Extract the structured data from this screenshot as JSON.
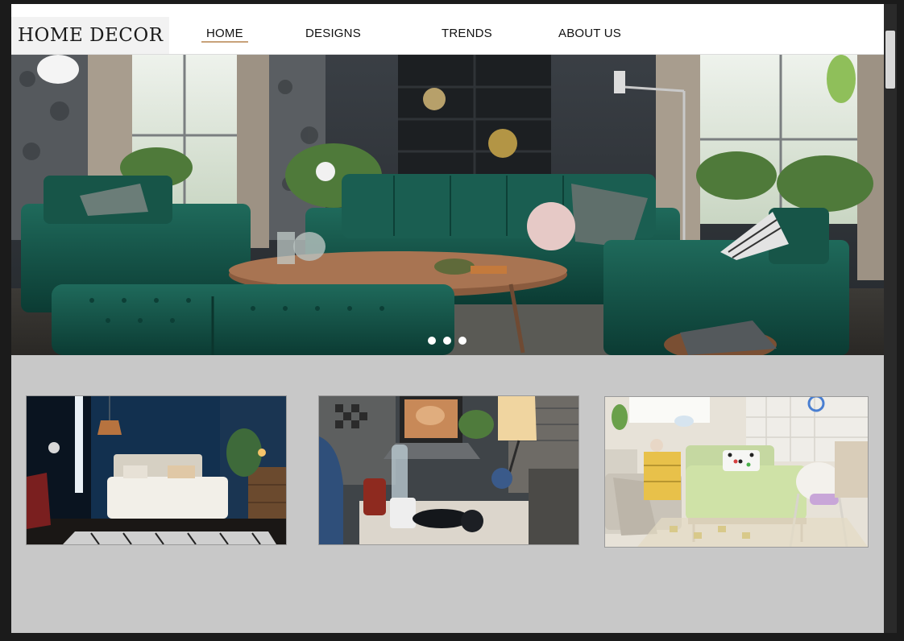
{
  "brand": {
    "logo_text": "HOME DECOR"
  },
  "nav": {
    "items": [
      {
        "label": "HOME",
        "active": true
      },
      {
        "label": "DESIGNS",
        "active": false
      },
      {
        "label": "TRENDS",
        "active": false
      },
      {
        "label": "ABOUT US",
        "active": false
      }
    ]
  },
  "hero": {
    "image": "living-room-green-velvet-sofa-photo",
    "slide_count": 3
  },
  "gallery": {
    "items": [
      {
        "image": "blue-bedroom-photo"
      },
      {
        "image": "desk-workspace-photo"
      },
      {
        "image": "kids-bedroom-photo"
      }
    ]
  },
  "colors": {
    "page_background": "#c8c8c8",
    "nav_background": "#ffffff",
    "active_underline": "#c8a27a",
    "frame": "#1b1b1b"
  }
}
